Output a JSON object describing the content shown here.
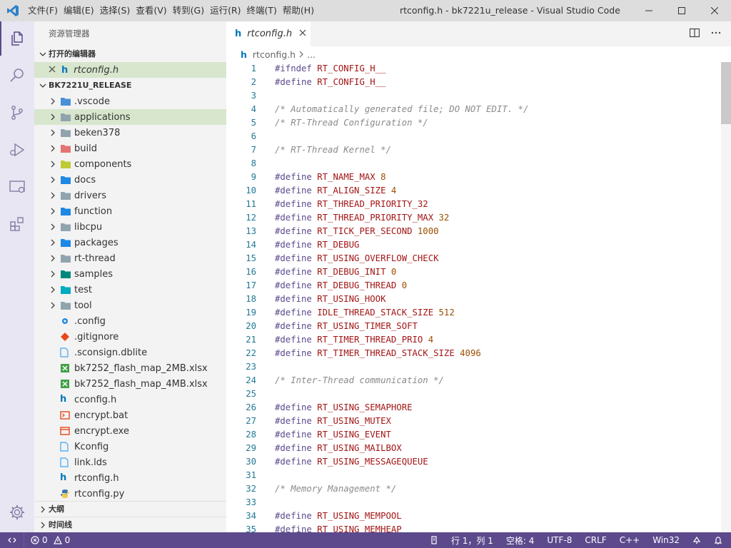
{
  "titlebar": {
    "menu": [
      "文件(F)",
      "编辑(E)",
      "选择(S)",
      "查看(V)",
      "转到(G)",
      "运行(R)",
      "终端(T)",
      "帮助(H)"
    ],
    "title": "rtconfig.h - bk7221u_release - Visual Studio Code"
  },
  "sidebar": {
    "title": "资源管理器",
    "open_editors_header": "打开的编辑器",
    "open_editor_file": "rtconfig.h",
    "project_header": "BK7221U_RELEASE",
    "tree": [
      {
        "label": ".vscode",
        "type": "folder",
        "icon": "vscode-folder-icon",
        "color": "#4a90d9"
      },
      {
        "label": "applications",
        "type": "folder",
        "icon": "folder-icon",
        "color": "#90a4ae"
      },
      {
        "label": "beken378",
        "type": "folder",
        "icon": "folder-icon",
        "color": "#90a4ae"
      },
      {
        "label": "build",
        "type": "folder",
        "icon": "build-folder-icon",
        "color": "#e57373"
      },
      {
        "label": "components",
        "type": "folder",
        "icon": "components-folder-icon",
        "color": "#c0ca33"
      },
      {
        "label": "docs",
        "type": "folder",
        "icon": "docs-folder-icon",
        "color": "#1e88e5"
      },
      {
        "label": "drivers",
        "type": "folder",
        "icon": "folder-icon",
        "color": "#90a4ae"
      },
      {
        "label": "function",
        "type": "folder",
        "icon": "function-folder-icon",
        "color": "#1e88e5"
      },
      {
        "label": "libcpu",
        "type": "folder",
        "icon": "folder-icon",
        "color": "#90a4ae"
      },
      {
        "label": "packages",
        "type": "folder",
        "icon": "packages-folder-icon",
        "color": "#1e88e5"
      },
      {
        "label": "rt-thread",
        "type": "folder",
        "icon": "folder-icon",
        "color": "#90a4ae"
      },
      {
        "label": "samples",
        "type": "folder",
        "icon": "samples-folder-icon",
        "color": "#00897b"
      },
      {
        "label": "test",
        "type": "folder",
        "icon": "test-folder-icon",
        "color": "#00acc1"
      },
      {
        "label": "tool",
        "type": "folder",
        "icon": "folder-icon",
        "color": "#90a4ae"
      },
      {
        "label": ".config",
        "type": "file",
        "icon": "gear-file-icon",
        "color": "#1e88e5"
      },
      {
        "label": ".gitignore",
        "type": "file",
        "icon": "git-file-icon",
        "color": "#e64a19"
      },
      {
        "label": ".sconsign.dblite",
        "type": "file",
        "icon": "document-file-icon",
        "color": "#42a5f5"
      },
      {
        "label": "bk7252_flash_map_2MB.xlsx",
        "type": "file",
        "icon": "excel-file-icon",
        "color": "#43a047"
      },
      {
        "label": "bk7252_flash_map_4MB.xlsx",
        "type": "file",
        "icon": "excel-file-icon",
        "color": "#43a047"
      },
      {
        "label": "cconfig.h",
        "type": "file",
        "icon": "header-file-icon",
        "color": "#0277bd"
      },
      {
        "label": "encrypt.bat",
        "type": "file",
        "icon": "console-file-icon",
        "color": "#e64a19"
      },
      {
        "label": "encrypt.exe",
        "type": "file",
        "icon": "exe-file-icon",
        "color": "#e64a19"
      },
      {
        "label": "Kconfig",
        "type": "file",
        "icon": "document-file-icon",
        "color": "#42a5f5"
      },
      {
        "label": "link.lds",
        "type": "file",
        "icon": "document-file-icon",
        "color": "#42a5f5"
      },
      {
        "label": "rtconfig.h",
        "type": "file",
        "icon": "header-file-icon",
        "color": "#0277bd"
      },
      {
        "label": "rtconfig.py",
        "type": "file",
        "icon": "python-file-icon",
        "color": "#3776ab"
      }
    ],
    "outline_header": "大纲",
    "timeline_header": "时间线"
  },
  "editor": {
    "tab_label": "rtconfig.h",
    "breadcrumb_file": "rtconfig.h",
    "breadcrumb_more": "...",
    "lines": [
      {
        "n": "1",
        "parts": [
          [
            "kw",
            "#ifndef"
          ],
          [
            "sp",
            " "
          ],
          [
            "id",
            "RT_CONFIG_H__"
          ]
        ]
      },
      {
        "n": "2",
        "parts": [
          [
            "kw",
            "#define"
          ],
          [
            "sp",
            " "
          ],
          [
            "id",
            "RT_CONFIG_H__"
          ]
        ]
      },
      {
        "n": "3",
        "parts": []
      },
      {
        "n": "4",
        "parts": [
          [
            "cm",
            "/* Automatically generated file; DO NOT EDIT. */"
          ]
        ]
      },
      {
        "n": "5",
        "parts": [
          [
            "cm",
            "/* RT-Thread Configuration */"
          ]
        ]
      },
      {
        "n": "6",
        "parts": []
      },
      {
        "n": "7",
        "parts": [
          [
            "cm",
            "/* RT-Thread Kernel */"
          ]
        ]
      },
      {
        "n": "8",
        "parts": []
      },
      {
        "n": "9",
        "parts": [
          [
            "kw",
            "#define"
          ],
          [
            "sp",
            " "
          ],
          [
            "id",
            "RT_NAME_MAX"
          ],
          [
            "sp",
            " "
          ],
          [
            "num",
            "8"
          ]
        ]
      },
      {
        "n": "10",
        "parts": [
          [
            "kw",
            "#define"
          ],
          [
            "sp",
            " "
          ],
          [
            "id",
            "RT_ALIGN_SIZE"
          ],
          [
            "sp",
            " "
          ],
          [
            "num",
            "4"
          ]
        ]
      },
      {
        "n": "11",
        "parts": [
          [
            "kw",
            "#define"
          ],
          [
            "sp",
            " "
          ],
          [
            "id",
            "RT_THREAD_PRIORITY_32"
          ]
        ]
      },
      {
        "n": "12",
        "parts": [
          [
            "kw",
            "#define"
          ],
          [
            "sp",
            " "
          ],
          [
            "id",
            "RT_THREAD_PRIORITY_MAX"
          ],
          [
            "sp",
            " "
          ],
          [
            "num",
            "32"
          ]
        ]
      },
      {
        "n": "13",
        "parts": [
          [
            "kw",
            "#define"
          ],
          [
            "sp",
            " "
          ],
          [
            "id",
            "RT_TICK_PER_SECOND"
          ],
          [
            "sp",
            " "
          ],
          [
            "num",
            "1000"
          ]
        ]
      },
      {
        "n": "14",
        "parts": [
          [
            "kw",
            "#define"
          ],
          [
            "sp",
            " "
          ],
          [
            "id",
            "RT_DEBUG"
          ]
        ]
      },
      {
        "n": "15",
        "parts": [
          [
            "kw",
            "#define"
          ],
          [
            "sp",
            " "
          ],
          [
            "id",
            "RT_USING_OVERFLOW_CHECK"
          ]
        ]
      },
      {
        "n": "16",
        "parts": [
          [
            "kw",
            "#define"
          ],
          [
            "sp",
            " "
          ],
          [
            "id",
            "RT_DEBUG_INIT"
          ],
          [
            "sp",
            " "
          ],
          [
            "num",
            "0"
          ]
        ]
      },
      {
        "n": "17",
        "parts": [
          [
            "kw",
            "#define"
          ],
          [
            "sp",
            " "
          ],
          [
            "id",
            "RT_DEBUG_THREAD"
          ],
          [
            "sp",
            " "
          ],
          [
            "num",
            "0"
          ]
        ]
      },
      {
        "n": "18",
        "parts": [
          [
            "kw",
            "#define"
          ],
          [
            "sp",
            " "
          ],
          [
            "id",
            "RT_USING_HOOK"
          ]
        ]
      },
      {
        "n": "19",
        "parts": [
          [
            "kw",
            "#define"
          ],
          [
            "sp",
            " "
          ],
          [
            "id",
            "IDLE_THREAD_STACK_SIZE"
          ],
          [
            "sp",
            " "
          ],
          [
            "num",
            "512"
          ]
        ]
      },
      {
        "n": "20",
        "parts": [
          [
            "kw",
            "#define"
          ],
          [
            "sp",
            " "
          ],
          [
            "id",
            "RT_USING_TIMER_SOFT"
          ]
        ]
      },
      {
        "n": "21",
        "parts": [
          [
            "kw",
            "#define"
          ],
          [
            "sp",
            " "
          ],
          [
            "id",
            "RT_TIMER_THREAD_PRIO"
          ],
          [
            "sp",
            " "
          ],
          [
            "num",
            "4"
          ]
        ]
      },
      {
        "n": "22",
        "parts": [
          [
            "kw",
            "#define"
          ],
          [
            "sp",
            " "
          ],
          [
            "id",
            "RT_TIMER_THREAD_STACK_SIZE"
          ],
          [
            "sp",
            " "
          ],
          [
            "num",
            "4096"
          ]
        ]
      },
      {
        "n": "23",
        "parts": []
      },
      {
        "n": "24",
        "parts": [
          [
            "cm",
            "/* Inter-Thread communication */"
          ]
        ]
      },
      {
        "n": "25",
        "parts": []
      },
      {
        "n": "26",
        "parts": [
          [
            "kw",
            "#define"
          ],
          [
            "sp",
            " "
          ],
          [
            "id",
            "RT_USING_SEMAPHORE"
          ]
        ]
      },
      {
        "n": "27",
        "parts": [
          [
            "kw",
            "#define"
          ],
          [
            "sp",
            " "
          ],
          [
            "id",
            "RT_USING_MUTEX"
          ]
        ]
      },
      {
        "n": "28",
        "parts": [
          [
            "kw",
            "#define"
          ],
          [
            "sp",
            " "
          ],
          [
            "id",
            "RT_USING_EVENT"
          ]
        ]
      },
      {
        "n": "29",
        "parts": [
          [
            "kw",
            "#define"
          ],
          [
            "sp",
            " "
          ],
          [
            "id",
            "RT_USING_MAILBOX"
          ]
        ]
      },
      {
        "n": "30",
        "parts": [
          [
            "kw",
            "#define"
          ],
          [
            "sp",
            " "
          ],
          [
            "id",
            "RT_USING_MESSAGEQUEUE"
          ]
        ]
      },
      {
        "n": "31",
        "parts": []
      },
      {
        "n": "32",
        "parts": [
          [
            "cm",
            "/* Memory Management */"
          ]
        ]
      },
      {
        "n": "33",
        "parts": []
      },
      {
        "n": "34",
        "parts": [
          [
            "kw",
            "#define"
          ],
          [
            "sp",
            " "
          ],
          [
            "id",
            "RT_USING_MEMPOOL"
          ]
        ]
      },
      {
        "n": "35",
        "parts": [
          [
            "kw",
            "#define"
          ],
          [
            "sp",
            " "
          ],
          [
            "id",
            "RT_USING_MEMHEAP"
          ]
        ]
      }
    ]
  },
  "statusbar": {
    "errors": "0",
    "warnings": "0",
    "position": "行 1，列 1",
    "spaces": "空格: 4",
    "encoding": "UTF-8",
    "eol": "CRLF",
    "language": "C++",
    "platform": "Win32"
  },
  "colors": {
    "accent": "#5c4a8c",
    "selection": "#d7e6cd",
    "keyword": "#5c4a8c",
    "identifier": "#a31515",
    "number": "#9b4f00",
    "comment": "#8a8a8a"
  }
}
